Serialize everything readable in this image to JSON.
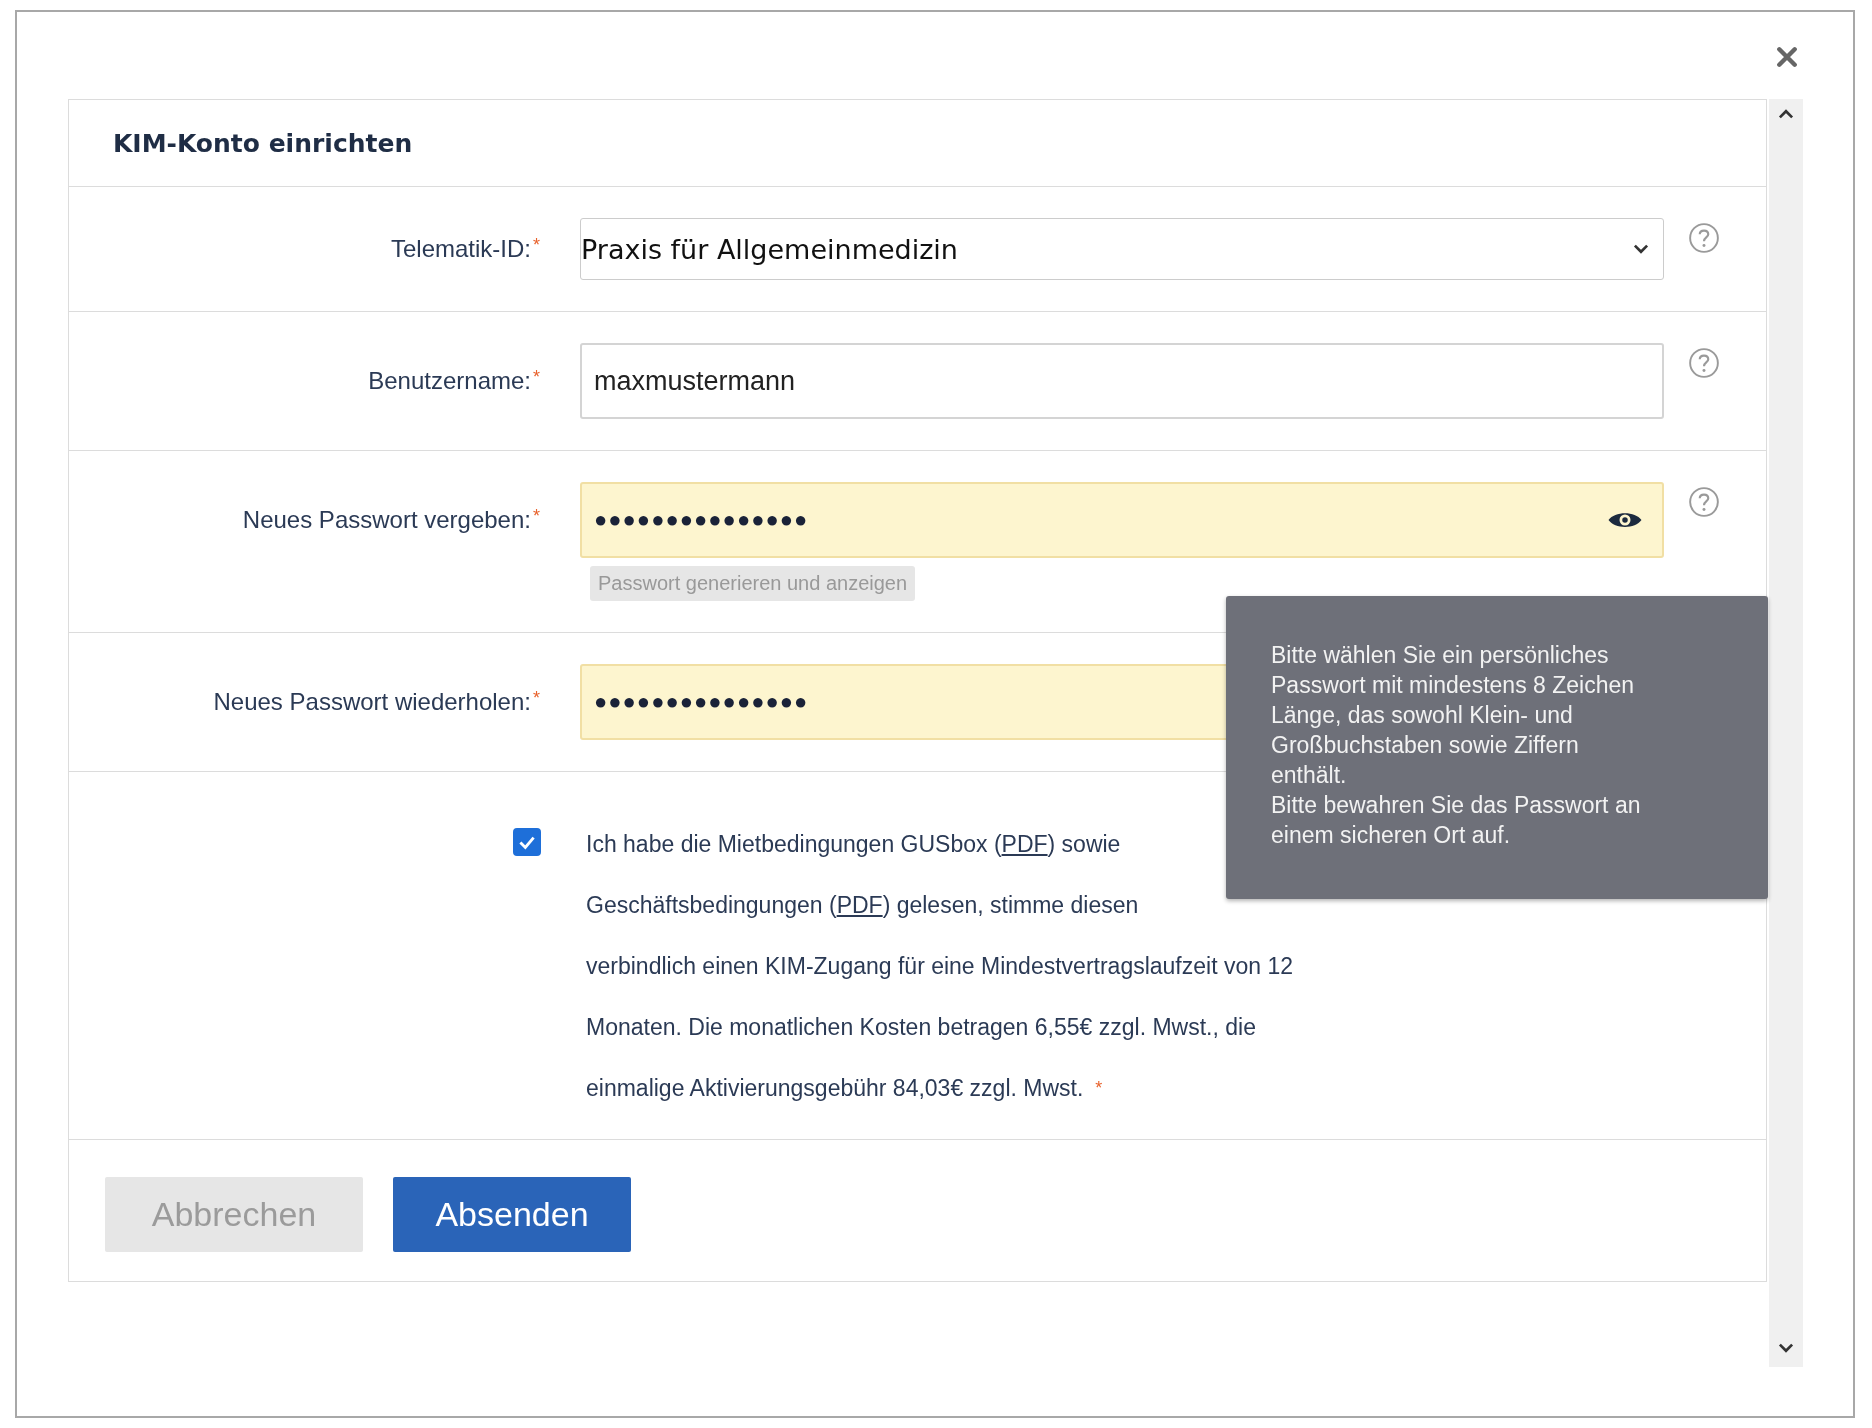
{
  "dialog": {
    "title": "KIM-Konto einrichten"
  },
  "fields": [
    {
      "kind": "select",
      "label": "Telematik-ID:",
      "required_mark": "*",
      "value": "Praxis für Allgemeinmedizin",
      "help": true
    },
    {
      "kind": "text",
      "label": "Benutzername:",
      "required_mark": "*",
      "value": "maxmustermann",
      "help": true
    },
    {
      "kind": "password",
      "label": "Neues Passwort vergeben:",
      "required_mark": "*",
      "value": "●●●●●●●●●●●●●●●",
      "reveal_toggle": true,
      "generate_button": "Passwort generieren und anzeigen",
      "help": true
    },
    {
      "kind": "password",
      "label": "Neues Passwort wiederholen:",
      "required_mark": "*",
      "value": "●●●●●●●●●●●●●●●",
      "reveal_toggle": false,
      "help": false
    }
  ],
  "tooltip": {
    "lines": [
      "Bitte wählen Sie ein persönliches",
      "Passwort mit mindestens 8 Zeichen",
      "Länge, das sowohl Klein- und",
      "Großbuchstaben sowie Ziffern",
      "enthält.",
      "Bitte bewahren Sie das Passwort an",
      "einem sicheren Ort auf."
    ]
  },
  "consent": {
    "checked": true,
    "required_mark": "*",
    "lines": [
      [
        {
          "kind": "text",
          "text": "Ich habe die Mietbedingungen GUSbox ("
        },
        {
          "kind": "link",
          "text": "PDF"
        },
        {
          "kind": "text",
          "text": ") sowie"
        }
      ],
      [
        {
          "kind": "text",
          "text": "Geschäftsbedingungen ("
        },
        {
          "kind": "link",
          "text": "PDF"
        },
        {
          "kind": "text",
          "text": ") gelesen, stimme diesen"
        }
      ],
      [
        {
          "kind": "text",
          "text": "verbindlich einen KIM-Zugang für eine Mindestvertragslaufzeit von 12"
        }
      ],
      [
        {
          "kind": "text",
          "text": "Monaten. Die monatlichen Kosten betragen 6,55€ zzgl. Mwst., die"
        }
      ],
      [
        {
          "kind": "text",
          "text": "einmalige Aktivierungsgebühr 84,03€ zzgl. Mwst."
        }
      ]
    ]
  },
  "buttons": [
    {
      "label": "Abbrechen",
      "disabled": true
    },
    {
      "label": "Absenden",
      "disabled": false
    }
  ]
}
